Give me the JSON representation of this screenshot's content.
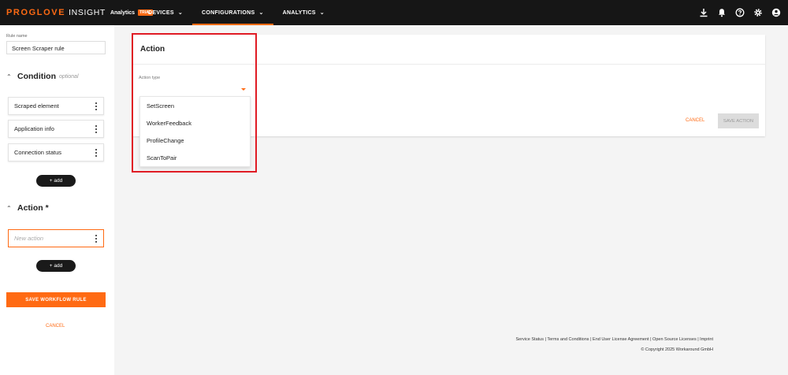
{
  "brand": {
    "name": "PROGLOVE",
    "product": "INSIGHT",
    "subproduct": "Analytics",
    "badge": "TRIAL"
  },
  "nav": [
    {
      "label": "DEVICES",
      "icon": "chevron-down-icon"
    },
    {
      "label": "CONFIGURATIONS",
      "icon": "chevron-down-icon",
      "active": true
    },
    {
      "label": "ANALYTICS",
      "icon": "chevron-down-icon"
    }
  ],
  "top_icons": [
    "download-icon",
    "bell-icon",
    "help-icon",
    "settings-icon",
    "account-icon"
  ],
  "left_panel": {
    "rule_name_label": "Rule name",
    "rule_name_value": "Screen Scraper rule",
    "condition": {
      "title": "Condition",
      "optional": "optional",
      "items": [
        "Scraped element",
        "Application info",
        "Connection status"
      ],
      "add_label": "+ add"
    },
    "action": {
      "title": "Action *",
      "new_action_placeholder": "New action",
      "add_label": "+ add"
    },
    "save_label": "SAVE WORKFLOW RULE",
    "cancel_label": "CANCEL"
  },
  "action_card": {
    "title": "Action",
    "action_type_label": "Action type",
    "action_type_value": "",
    "options": [
      "SetScreen",
      "WorkerFeedback",
      "ProfileChange",
      "ScanToPair"
    ],
    "cancel_label": "CANCEL",
    "save_label": "SAVE ACTION"
  },
  "footer": {
    "links": "Service Status | Terms and Conditions | End User License Agreement | Open Source Licenses | Imprint",
    "copyright": "© Copyright 2025 Workaround GmbH"
  },
  "colors": {
    "accent": "#ff6a13",
    "topbar": "#161616",
    "highlight": "#e01b24"
  }
}
